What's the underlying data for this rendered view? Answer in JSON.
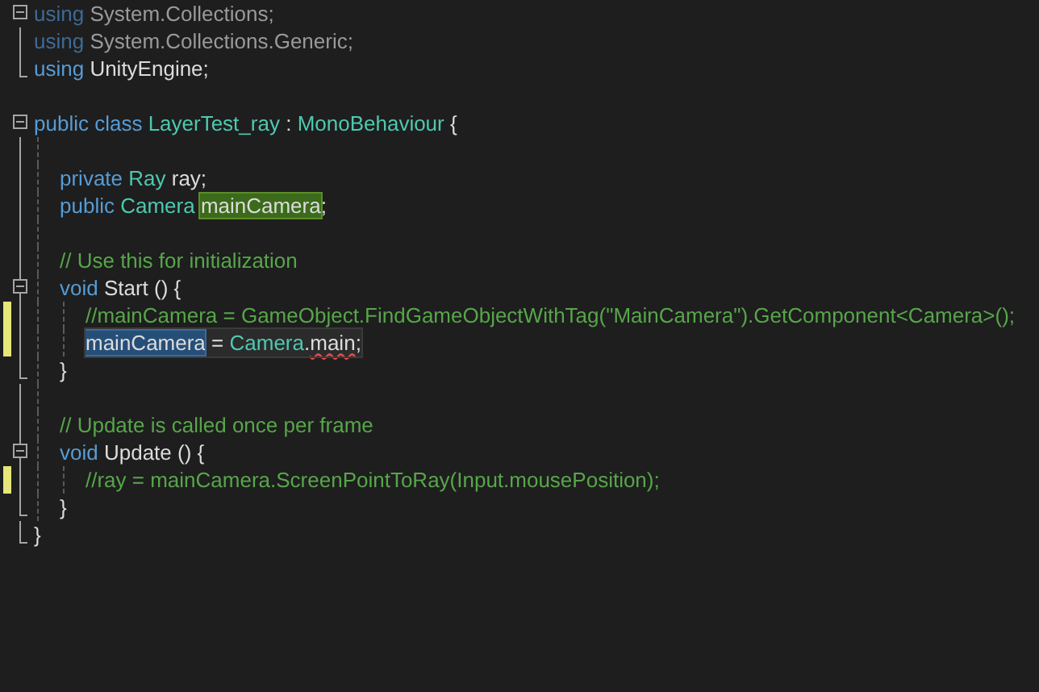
{
  "code": [
    {
      "kind": "group",
      "collapsible": true,
      "lines": [
        {
          "faded": true,
          "tokens": [
            {
              "text": "using",
              "kind": "keyword"
            },
            {
              "text": " System.Collections;",
              "kind": "plain"
            }
          ]
        },
        {
          "faded": true,
          "tokens": [
            {
              "text": "using",
              "kind": "keyword"
            },
            {
              "text": " System.Collections.Generic;",
              "kind": "plain"
            }
          ]
        },
        {
          "faded": false,
          "tokens": [
            {
              "text": "using",
              "kind": "keyword"
            },
            {
              "text": " UnityEngine;",
              "kind": "plain"
            }
          ]
        }
      ]
    },
    {
      "kind": "blank"
    },
    {
      "kind": "block",
      "collapsible": true,
      "header": [
        {
          "text": "public class ",
          "kind": "keyword"
        },
        {
          "text": "LayerTest_ray",
          "kind": "type"
        },
        {
          "text": " : ",
          "kind": "plain"
        },
        {
          "text": "MonoBehaviour",
          "kind": "type"
        },
        {
          "text": " {",
          "kind": "plain"
        }
      ],
      "children": [
        {
          "kind": "blank"
        },
        {
          "kind": "line",
          "tokens": [
            {
              "text": "private ",
              "kind": "keyword"
            },
            {
              "text": "Ray",
              "kind": "type"
            },
            {
              "text": " ray;",
              "kind": "plain"
            }
          ]
        },
        {
          "kind": "line",
          "tokens": [
            {
              "text": "public ",
              "kind": "keyword"
            },
            {
              "text": "Camera ",
              "kind": "type"
            },
            {
              "text": "mainCamera",
              "kind": "reference"
            },
            {
              "text": ";",
              "kind": "plain"
            }
          ]
        },
        {
          "kind": "blank"
        },
        {
          "kind": "line",
          "tokens": [
            {
              "text": "// Use this for initialization",
              "kind": "comment"
            }
          ]
        },
        {
          "kind": "block",
          "collapsible": true,
          "header": [
            {
              "text": "void ",
              "kind": "keyword"
            },
            {
              "text": "Start () {",
              "kind": "plain"
            }
          ],
          "children": [
            {
              "kind": "line",
              "changed": true,
              "tokens": [
                {
                  "text": "//mainCamera = GameObject.FindGameObjectWithTag(\"MainCamera\").GetComponent<Camera>();",
                  "kind": "comment"
                }
              ]
            },
            {
              "kind": "line",
              "changed": true,
              "current": true,
              "tokens": [
                {
                  "text": "mainCamera",
                  "kind": "selection"
                },
                {
                  "text": " = ",
                  "kind": "plain"
                },
                {
                  "text": "Camera",
                  "kind": "type"
                },
                {
                  "text": ".",
                  "kind": "plain"
                },
                {
                  "text": "main",
                  "kind": "plain",
                  "squiggle": true
                },
                {
                  "text": ";",
                  "kind": "plain"
                }
              ]
            }
          ],
          "footer": [
            {
              "text": "}",
              "kind": "plain"
            }
          ]
        },
        {
          "kind": "blank"
        },
        {
          "kind": "line",
          "tokens": [
            {
              "text": "// Update is called once per frame",
              "kind": "comment"
            }
          ]
        },
        {
          "kind": "block",
          "collapsible": true,
          "header": [
            {
              "text": "void ",
              "kind": "keyword"
            },
            {
              "text": "Update () {",
              "kind": "plain"
            }
          ],
          "children": [
            {
              "kind": "line",
              "changed": true,
              "tokens": [
                {
                  "text": "//ray = mainCamera.ScreenPointToRay(Input.mousePosition);",
                  "kind": "comment"
                }
              ]
            }
          ],
          "footer": [
            {
              "text": "}",
              "kind": "plain"
            }
          ]
        }
      ],
      "footer": [
        {
          "text": "}",
          "kind": "plain"
        }
      ]
    }
  ]
}
